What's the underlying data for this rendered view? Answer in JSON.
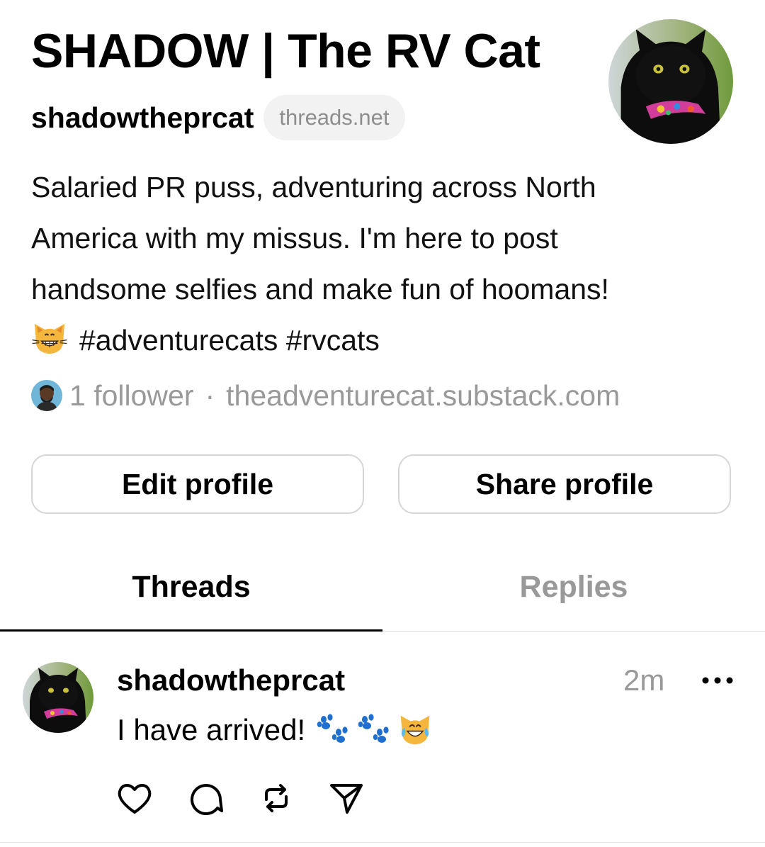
{
  "profile": {
    "display_name": "SHADOW | The RV Cat",
    "username": "shadowtheprcat",
    "domain_badge": "threads.net",
    "bio_lines": [
      "Salaried PR puss, adventuring across North",
      "America with my missus. I'm here to post",
      "handsome selfies and make fun of hoomans!",
      "#adventurecats #rvcats"
    ],
    "bio_emoji": "grinning-cat-emoji",
    "followers_text": "1 follower",
    "separator": "·",
    "link": "theadventurecat.substack.com"
  },
  "buttons": {
    "edit_label": "Edit profile",
    "share_label": "Share profile"
  },
  "tabs": [
    {
      "label": "Threads",
      "active": true
    },
    {
      "label": "Replies",
      "active": false
    }
  ],
  "post": {
    "username": "shadowtheprcat",
    "time": "2m",
    "text": "I have arrived!",
    "emojis": [
      "paw-prints-emoji",
      "paw-prints-emoji",
      "cat-with-tears-of-joy-emoji"
    ],
    "actions": [
      "heart-icon",
      "comment-icon",
      "repost-icon",
      "send-icon"
    ]
  },
  "colors": {
    "text": "#000000",
    "muted": "#999999",
    "pill_bg": "#f2f2f2",
    "border": "#d6d6d6"
  }
}
